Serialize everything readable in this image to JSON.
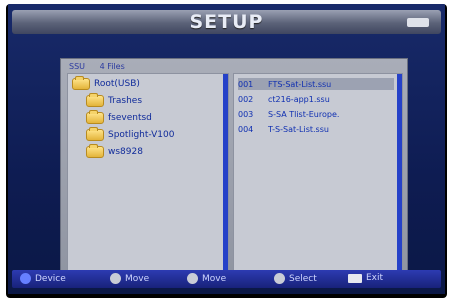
{
  "title": "SETUP",
  "browser": {
    "device_label": "SSU",
    "file_count": "4 Files"
  },
  "tree": {
    "root": "Root(USB)",
    "folders": [
      "Trashes",
      "fseventsd",
      "Spotlight-V100",
      "ws8928"
    ]
  },
  "files": [
    {
      "num": "001",
      "name": "FTS-Sat-List.ssu"
    },
    {
      "num": "002",
      "name": "ct216-app1.ssu"
    },
    {
      "num": "003",
      "name": "S-SA Tlist-Europe."
    },
    {
      "num": "004",
      "name": "T-S-Sat-List.ssu"
    }
  ],
  "bottom_hints": [
    {
      "label": "Device",
      "icon": "blue-circle-icon"
    },
    {
      "label": "Move",
      "icon": "updown-arrow-icon"
    },
    {
      "label": "Move",
      "icon": "leftright-arrow-icon"
    },
    {
      "label": "Select",
      "icon": "ok-icon"
    },
    {
      "label": "Exit",
      "icon": "exit-icon"
    }
  ]
}
